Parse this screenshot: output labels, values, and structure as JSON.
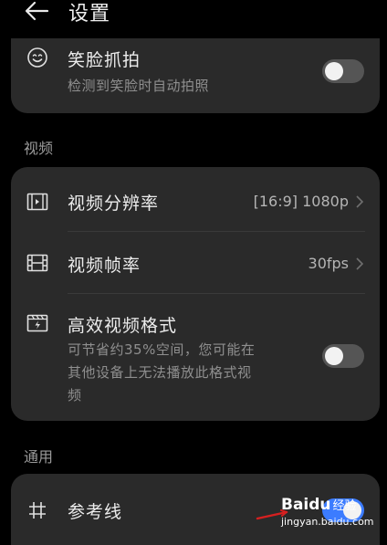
{
  "header": {
    "title": "设置",
    "back_icon": "arrow-left-icon"
  },
  "top_card": {
    "smile_capture": {
      "icon": "smile-face-icon",
      "title": "笑脸抓拍",
      "subtitle": "检测到笑脸时自动拍照",
      "toggle_on": false
    }
  },
  "sections": {
    "video_label": "视频",
    "general_label": "通用"
  },
  "video_card": {
    "resolution": {
      "icon": "video-resolution-icon",
      "title": "视频分辨率",
      "value": "[16:9] 1080p"
    },
    "frame_rate": {
      "icon": "film-strip-icon",
      "title": "视频帧率",
      "value": "30fps"
    },
    "efficient_format": {
      "icon": "efficient-format-icon",
      "title": "高效视频格式",
      "subtitle_lines": [
        "可节省约35%空间，您可能在",
        "其他设备上无法播放此格式视",
        "频"
      ],
      "toggle_on": false
    }
  },
  "general_card": {
    "grid_lines": {
      "icon": "hash-grid-icon",
      "title": "参考线",
      "toggle_on": true
    }
  },
  "watermark": {
    "brand": "Baidu",
    "brand_suffix": "经验",
    "url": "jingyan.baidu.com"
  },
  "colors": {
    "background": "#000000",
    "card": "#2a2a2a",
    "accent": "#3c7cff",
    "toggle_off": "#555555"
  }
}
